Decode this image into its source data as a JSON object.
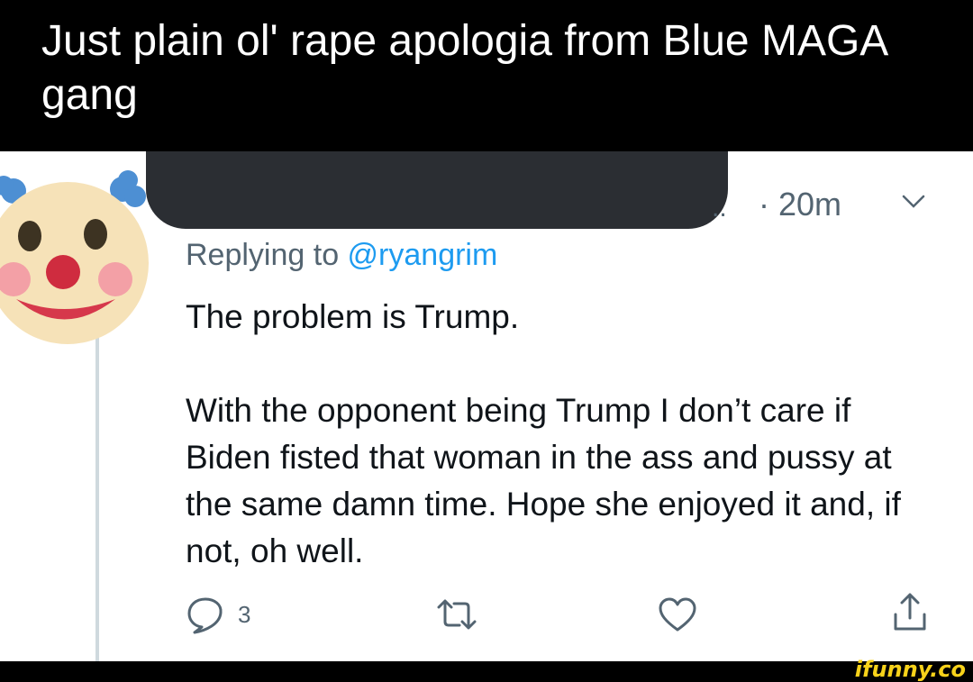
{
  "post_title": "Just plain ol' rape apologia from Blue MAGA gang",
  "tweet": {
    "avatar_icon": "clown-face-icon",
    "time": "· 20m",
    "ellipsis": "..",
    "replying_to_prefix": "Replying to ",
    "replying_to_handle": "@ryangrim",
    "paragraph_1": "The problem is Trump.",
    "paragraph_2": "With the opponent being Trump I don’t care if Biden fisted that woman in the ass and pussy at the same damn time. Hope she enjoyed it and, if not, oh well.",
    "reply_count": "3"
  },
  "actions": {
    "reply_icon": "speech-bubble-icon",
    "retweet_icon": "retweet-icon",
    "like_icon": "heart-icon",
    "share_icon": "share-icon"
  },
  "watermark": "ifunny.co",
  "colors": {
    "background": "#000000",
    "card": "#ffffff",
    "secondary_text": "#536471",
    "link": "#1d9bf0",
    "watermark": "#f7d21a"
  }
}
